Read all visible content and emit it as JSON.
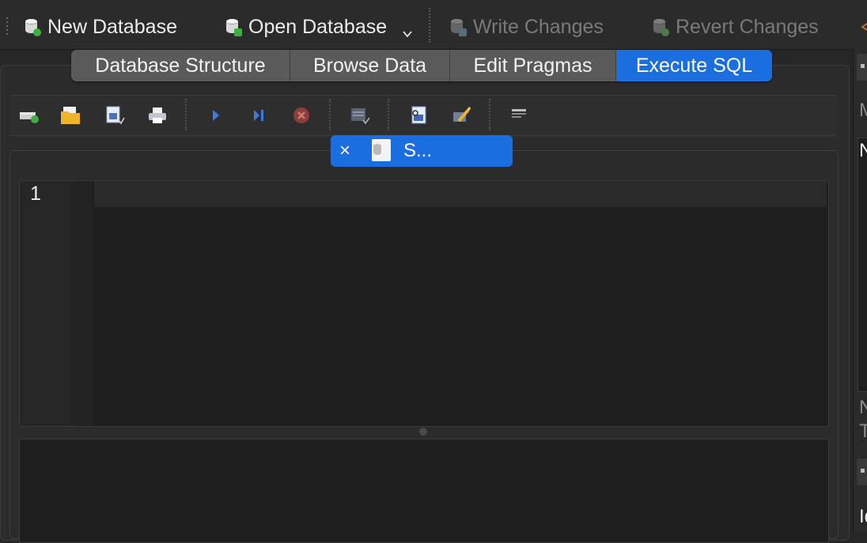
{
  "toolbar": {
    "new_database": "New Database",
    "open_database": "Open Database",
    "write_changes": "Write Changes",
    "revert_changes": "Revert Changes"
  },
  "tabs": [
    {
      "label": "Database Structure",
      "active": false
    },
    {
      "label": "Browse Data",
      "active": false
    },
    {
      "label": "Edit Pragmas",
      "active": false
    },
    {
      "label": "Execute SQL",
      "active": true
    }
  ],
  "sql_toolbar_icons": [
    "open-tab-icon",
    "open-sql-file-icon",
    "save-sql-file-icon",
    "print-icon",
    "execute-all-icon",
    "execute-line-icon",
    "stop-execution-icon",
    "save-results-icon",
    "find-icon",
    "find-replace-icon",
    "comment-icon"
  ],
  "editor_tab": {
    "title": "S...",
    "close_glyph": "×"
  },
  "editor": {
    "line_number": "1"
  },
  "right_dock": {
    "letters": [
      "M",
      "N",
      "N",
      "T",
      "Id"
    ]
  },
  "colors": {
    "accent": "#1a6ee0",
    "background": "#262626",
    "editor": "#1e1e1e"
  }
}
